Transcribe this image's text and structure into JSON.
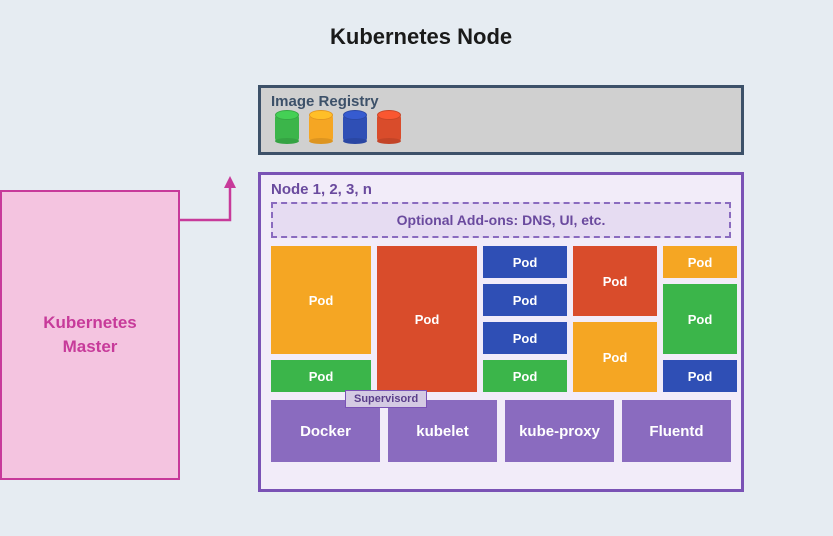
{
  "title": "Kubernetes Node",
  "master": {
    "label": "Kubernetes\nMaster"
  },
  "registry": {
    "title": "Image Registry",
    "images": [
      {
        "color": "green"
      },
      {
        "color": "orange"
      },
      {
        "color": "blue"
      },
      {
        "color": "red"
      }
    ]
  },
  "node": {
    "title": "Node 1, 2, 3, n",
    "addons_label": "Optional Add-ons: DNS, UI, etc.",
    "pods": {
      "col1_top": "Pod",
      "col1_bot": "Pod",
      "col2": "Pod",
      "col3_r1": "Pod",
      "col3_r2": "Pod",
      "col3_r3": "Pod",
      "col3_r4": "Pod",
      "col4_top": "Pod",
      "col4_bot": "Pod",
      "col5_r1": "Pod",
      "col5_mid": "Pod",
      "col5_r4": "Pod"
    },
    "supervisord_label": "Supervisord",
    "daemons": [
      {
        "name": "Docker"
      },
      {
        "name": "kubelet"
      },
      {
        "name": "kube-proxy"
      },
      {
        "name": "Fluentd"
      }
    ]
  },
  "colors": {
    "orange": "#f5a623",
    "green": "#3bb54a",
    "blue": "#2f4fb5",
    "red": "#d94c2b",
    "purple": "#8a6bbf",
    "pink": "#f4c4e0",
    "magenta": "#c73a9a",
    "slate": "#3d5169"
  }
}
